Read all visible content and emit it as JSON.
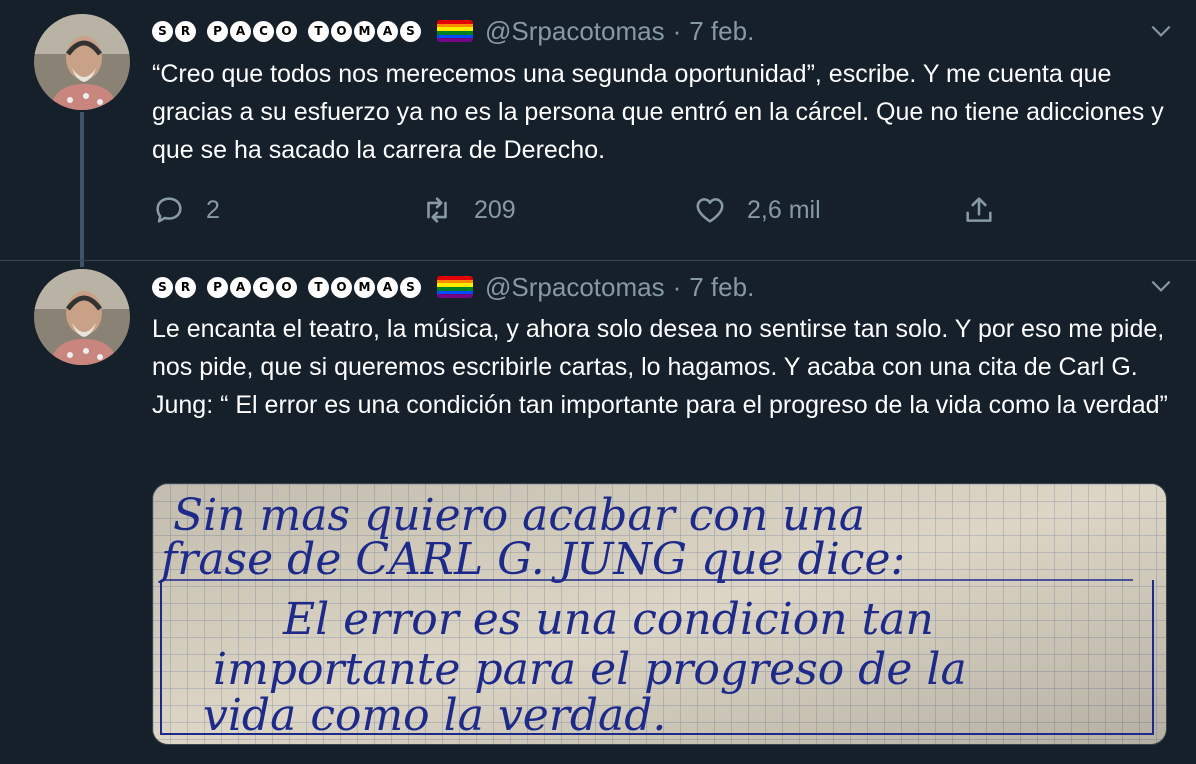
{
  "tweets": [
    {
      "author": {
        "badges": [
          "S",
          "R",
          "P",
          "A",
          "C",
          "O",
          "T",
          "O",
          "M",
          "A",
          "S"
        ],
        "flag_icon": "rainbow-flag-icon",
        "handle": "@Srpacotomas",
        "separator": "·",
        "date": "7 feb."
      },
      "text": "“Creo que todos nos merecemos una segunda oportunidad”, escribe. Y me cuenta que gracias a su esfuerzo ya no es la persona que entró en la cárcel. Que no tiene adicciones y que se ha sacado la carrera de Derecho.",
      "actions": {
        "reply_count": "2",
        "retweet_count": "209",
        "like_count": "2,6 mil"
      }
    },
    {
      "author": {
        "badges": [
          "S",
          "R",
          "P",
          "A",
          "C",
          "O",
          "T",
          "O",
          "M",
          "A",
          "S"
        ],
        "flag_icon": "rainbow-flag-icon",
        "handle": "@Srpacotomas",
        "separator": "·",
        "date": "7 feb."
      },
      "text": "Le encanta el teatro, la música, y ahora solo desea no sentirse tan solo. Y por eso me pide, nos pide, que si queremos escribirle cartas, lo hagamos. Y acaba con una cita de Carl G. Jung: “ El error es una condición tan importante para el progreso de la vida como la verdad”",
      "media": {
        "handwritten_lines": [
          "Sin mas quiero acabar con una",
          "frase de CARL G. JUNG que dice:",
          "El error es una condicion tan",
          "importante para el progreso de la",
          "vida como la verdad."
        ]
      }
    }
  ],
  "colors": {
    "background": "#15202b",
    "text": "#ffffff",
    "muted": "#8899a6",
    "divider": "#38444d",
    "thread_line": "#3d5466",
    "ink": "#1e2a8a",
    "paper": "#ddd6c6"
  },
  "flag_colors": [
    "#e40303",
    "#ff8c00",
    "#ffed00",
    "#008026",
    "#004dff",
    "#750787"
  ]
}
